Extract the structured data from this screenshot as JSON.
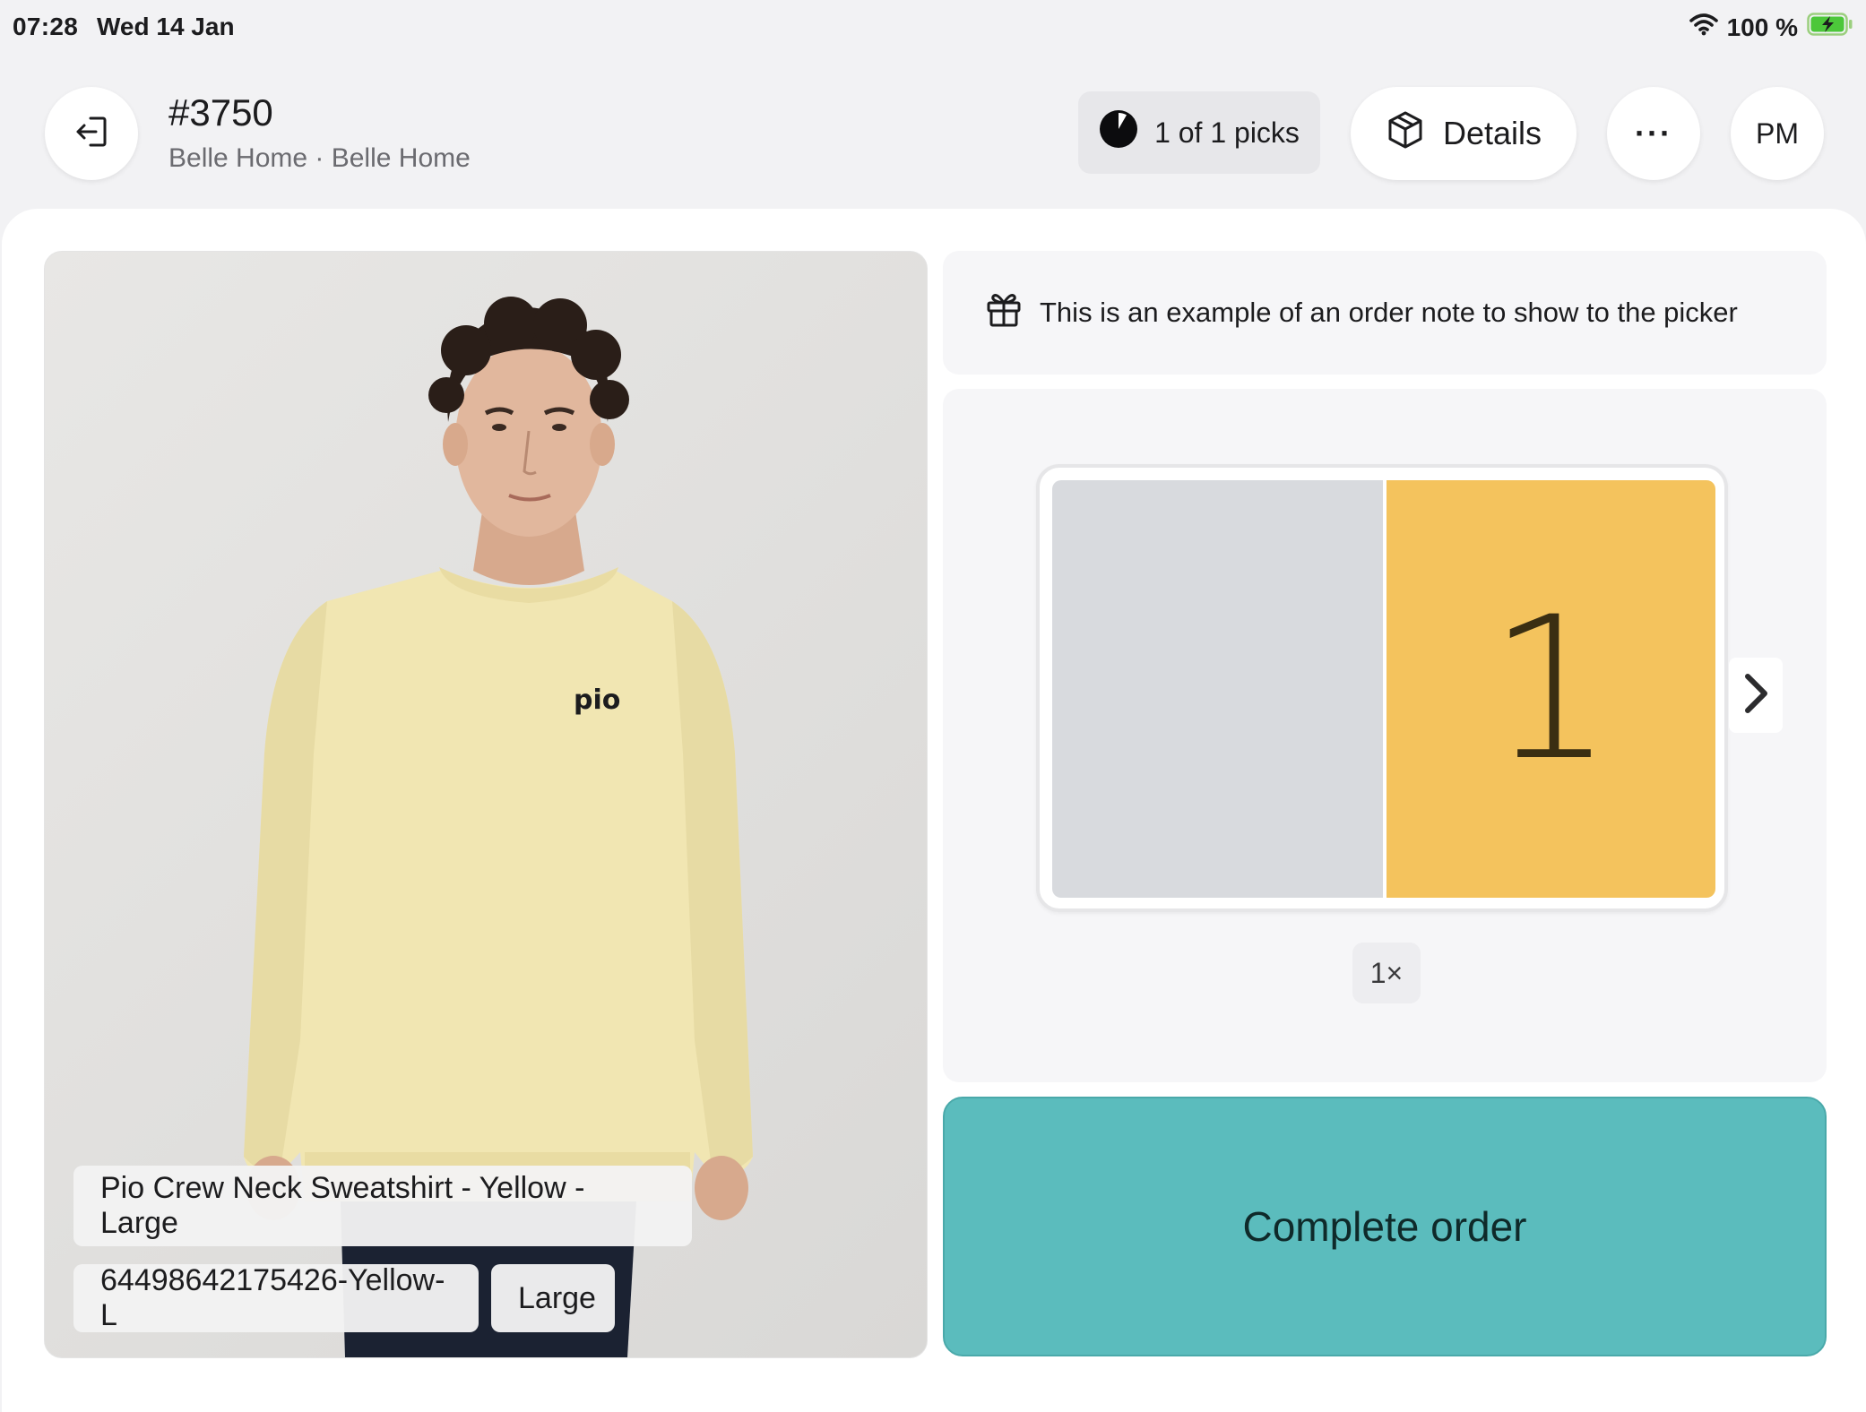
{
  "status_bar": {
    "time": "07:28",
    "date": "Wed 14 Jan",
    "battery": "100 %",
    "icons": [
      "wifi-icon",
      "battery-charging-icon"
    ]
  },
  "header": {
    "back_icon": "exit-icon",
    "order_number": "#3750",
    "subtitle": "Belle Home · Belle Home",
    "picks_label": "1 of 1 picks",
    "details_label": "Details",
    "more_label": "···",
    "user_initials": "PM"
  },
  "product": {
    "name": "Pio Crew Neck Sweatshirt - Yellow - Large",
    "sku": "64498642175426-Yellow-L",
    "variant": "Large",
    "image_logo_text": "pio"
  },
  "note": {
    "icon": "gift-icon",
    "text": "This is an example of an order note to show to the picker"
  },
  "bin": {
    "slot_number": "1",
    "quantity": "1×",
    "colors": {
      "active_slot": "#f4c35d",
      "inactive_slot": "#d8dade"
    }
  },
  "actions": {
    "complete_label": "Complete order",
    "complete_color": "#5bbcbd"
  }
}
